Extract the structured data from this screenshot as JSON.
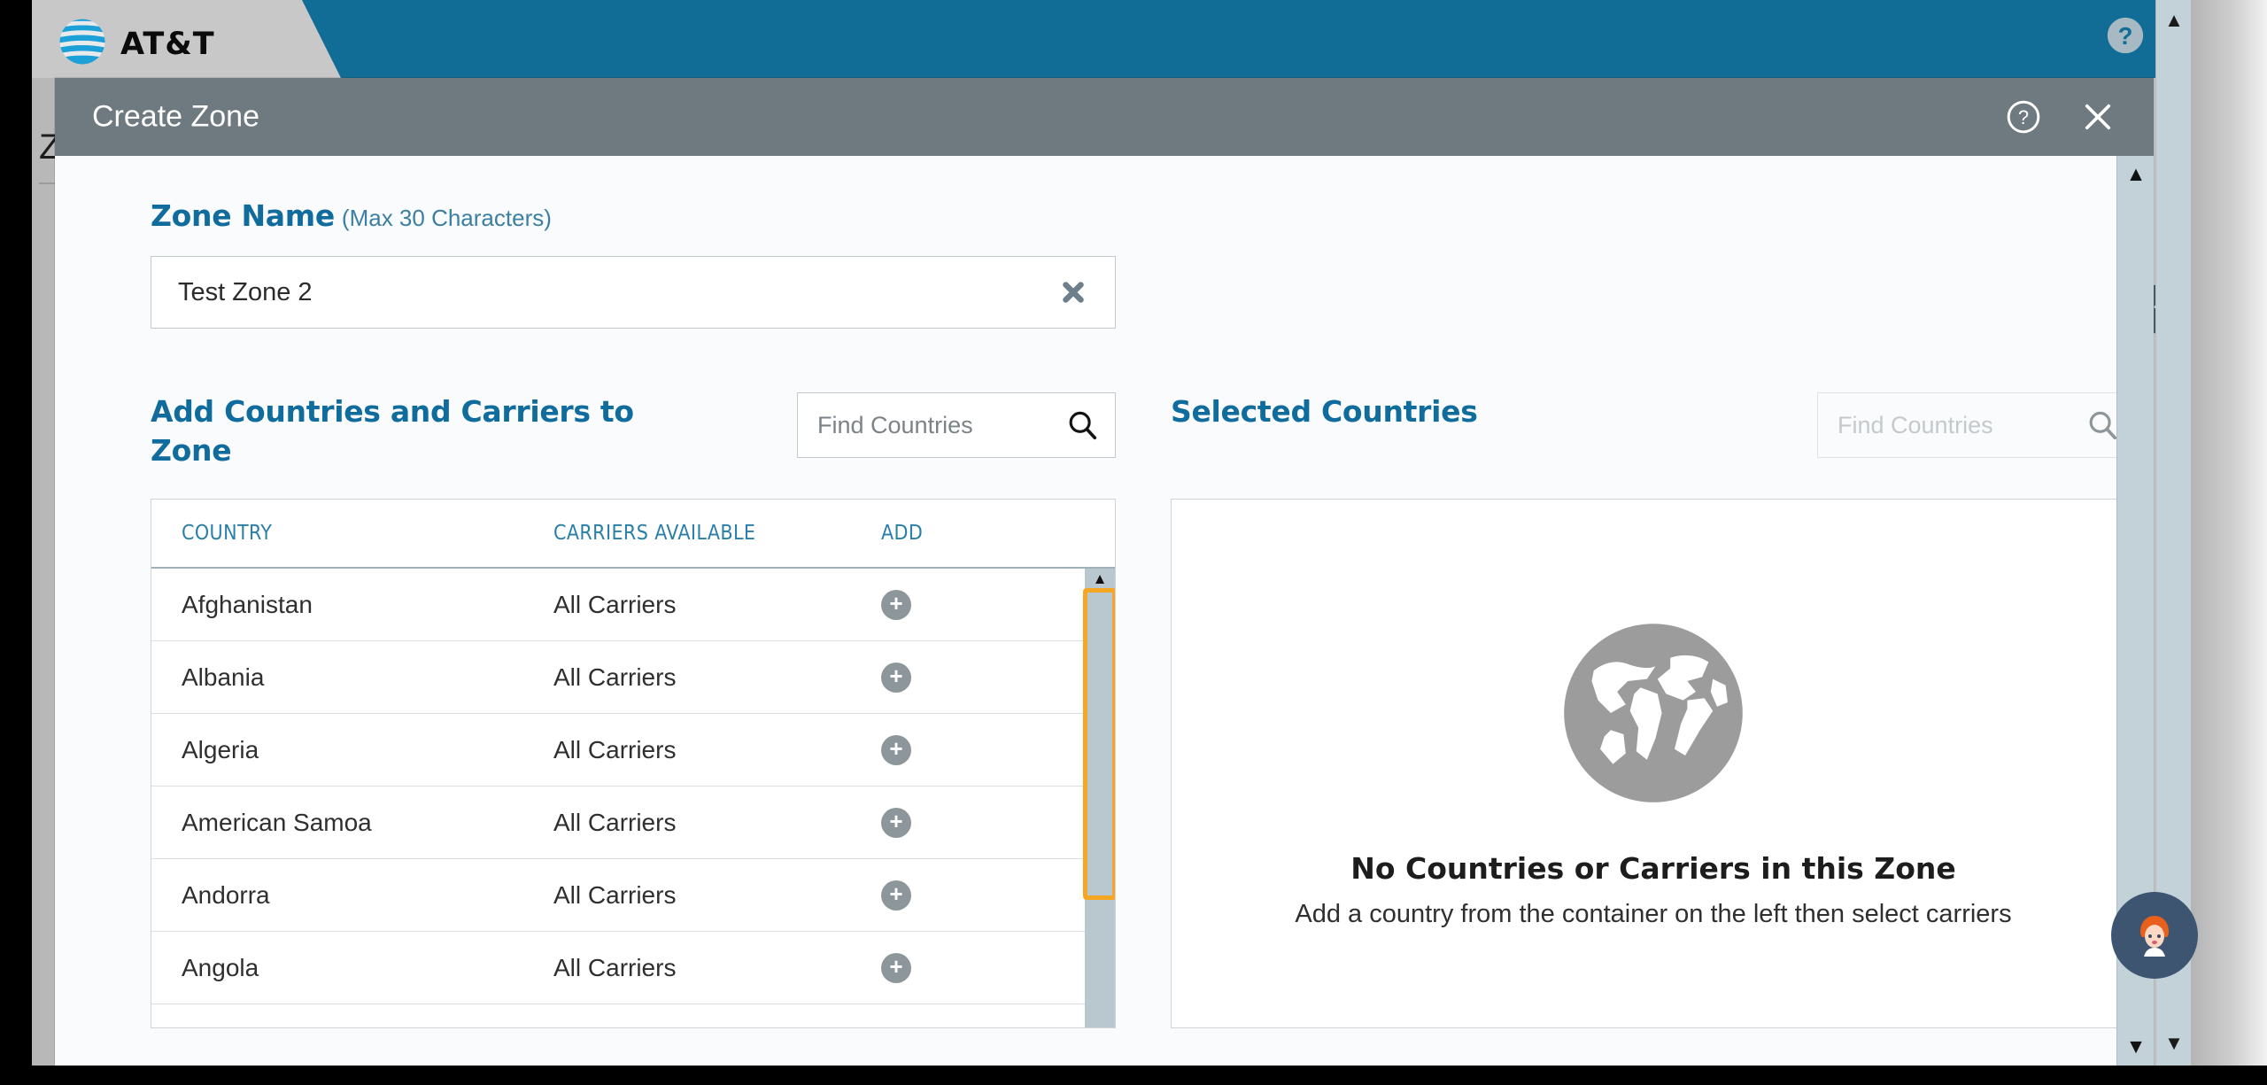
{
  "app": {
    "brand": "AT&T",
    "header_icons": [
      "help-circle-icon",
      "user-account-icon"
    ],
    "background": {
      "page_title": "ZO",
      "add_button_label": "+"
    },
    "assistant_button_label": "virtual-assistant"
  },
  "modal": {
    "title": "Create Zone",
    "help_icon": "help-circle-icon",
    "close_icon": "close-icon",
    "zone_name": {
      "label": "Zone Name",
      "hint": "(Max 30 Characters)",
      "value": "Test Zone 2",
      "placeholder": "",
      "clear_icon": "clear-x-icon"
    },
    "left_panel": {
      "title": "Add Countries and Carriers to Zone",
      "search": {
        "placeholder": "Find Countries",
        "value": "",
        "icon": "search-icon",
        "disabled": false
      },
      "table": {
        "columns": [
          "COUNTRY",
          "CARRIERS AVAILABLE",
          "ADD"
        ],
        "rows": [
          {
            "country": "Afghanistan",
            "carriers": "All Carriers",
            "add": "+"
          },
          {
            "country": "Albania",
            "carriers": "All Carriers",
            "add": "+"
          },
          {
            "country": "Algeria",
            "carriers": "All Carriers",
            "add": "+"
          },
          {
            "country": "American Samoa",
            "carriers": "All Carriers",
            "add": "+"
          },
          {
            "country": "Andorra",
            "carriers": "All Carriers",
            "add": "+"
          },
          {
            "country": "Angola",
            "carriers": "All Carriers",
            "add": "+"
          }
        ],
        "scrollbar_highlight_color": "#f5a623"
      }
    },
    "right_panel": {
      "title": "Selected Countries",
      "search": {
        "placeholder": "Find Countries",
        "value": "",
        "icon": "search-icon",
        "disabled": true
      },
      "empty_state": {
        "icon": "globe-icon",
        "title": "No Countries or Carriers in this Zone",
        "subtitle": "Add a country from the container on the left then select carriers"
      }
    }
  },
  "colors": {
    "brand_teal": "#116d96",
    "modal_header_gray": "#6e7a80",
    "link_blue": "#0f6c9c",
    "highlight_orange": "#f5a623"
  }
}
